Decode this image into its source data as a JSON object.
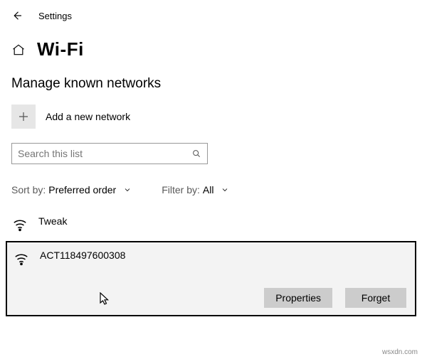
{
  "topbar": {
    "settings_label": "Settings"
  },
  "header": {
    "title": "Wi-Fi"
  },
  "section": {
    "manage_title": "Manage known networks"
  },
  "add": {
    "label": "Add a new network"
  },
  "search": {
    "placeholder": "Search this list"
  },
  "filters": {
    "sort_label": "Sort by:",
    "sort_value": "Preferred order",
    "filter_label": "Filter by:",
    "filter_value": "All"
  },
  "networks": [
    {
      "name": "Tweak"
    },
    {
      "name": "ACT118497600308"
    }
  ],
  "buttons": {
    "properties": "Properties",
    "forget": "Forget"
  },
  "watermark": "wsxdn.com"
}
